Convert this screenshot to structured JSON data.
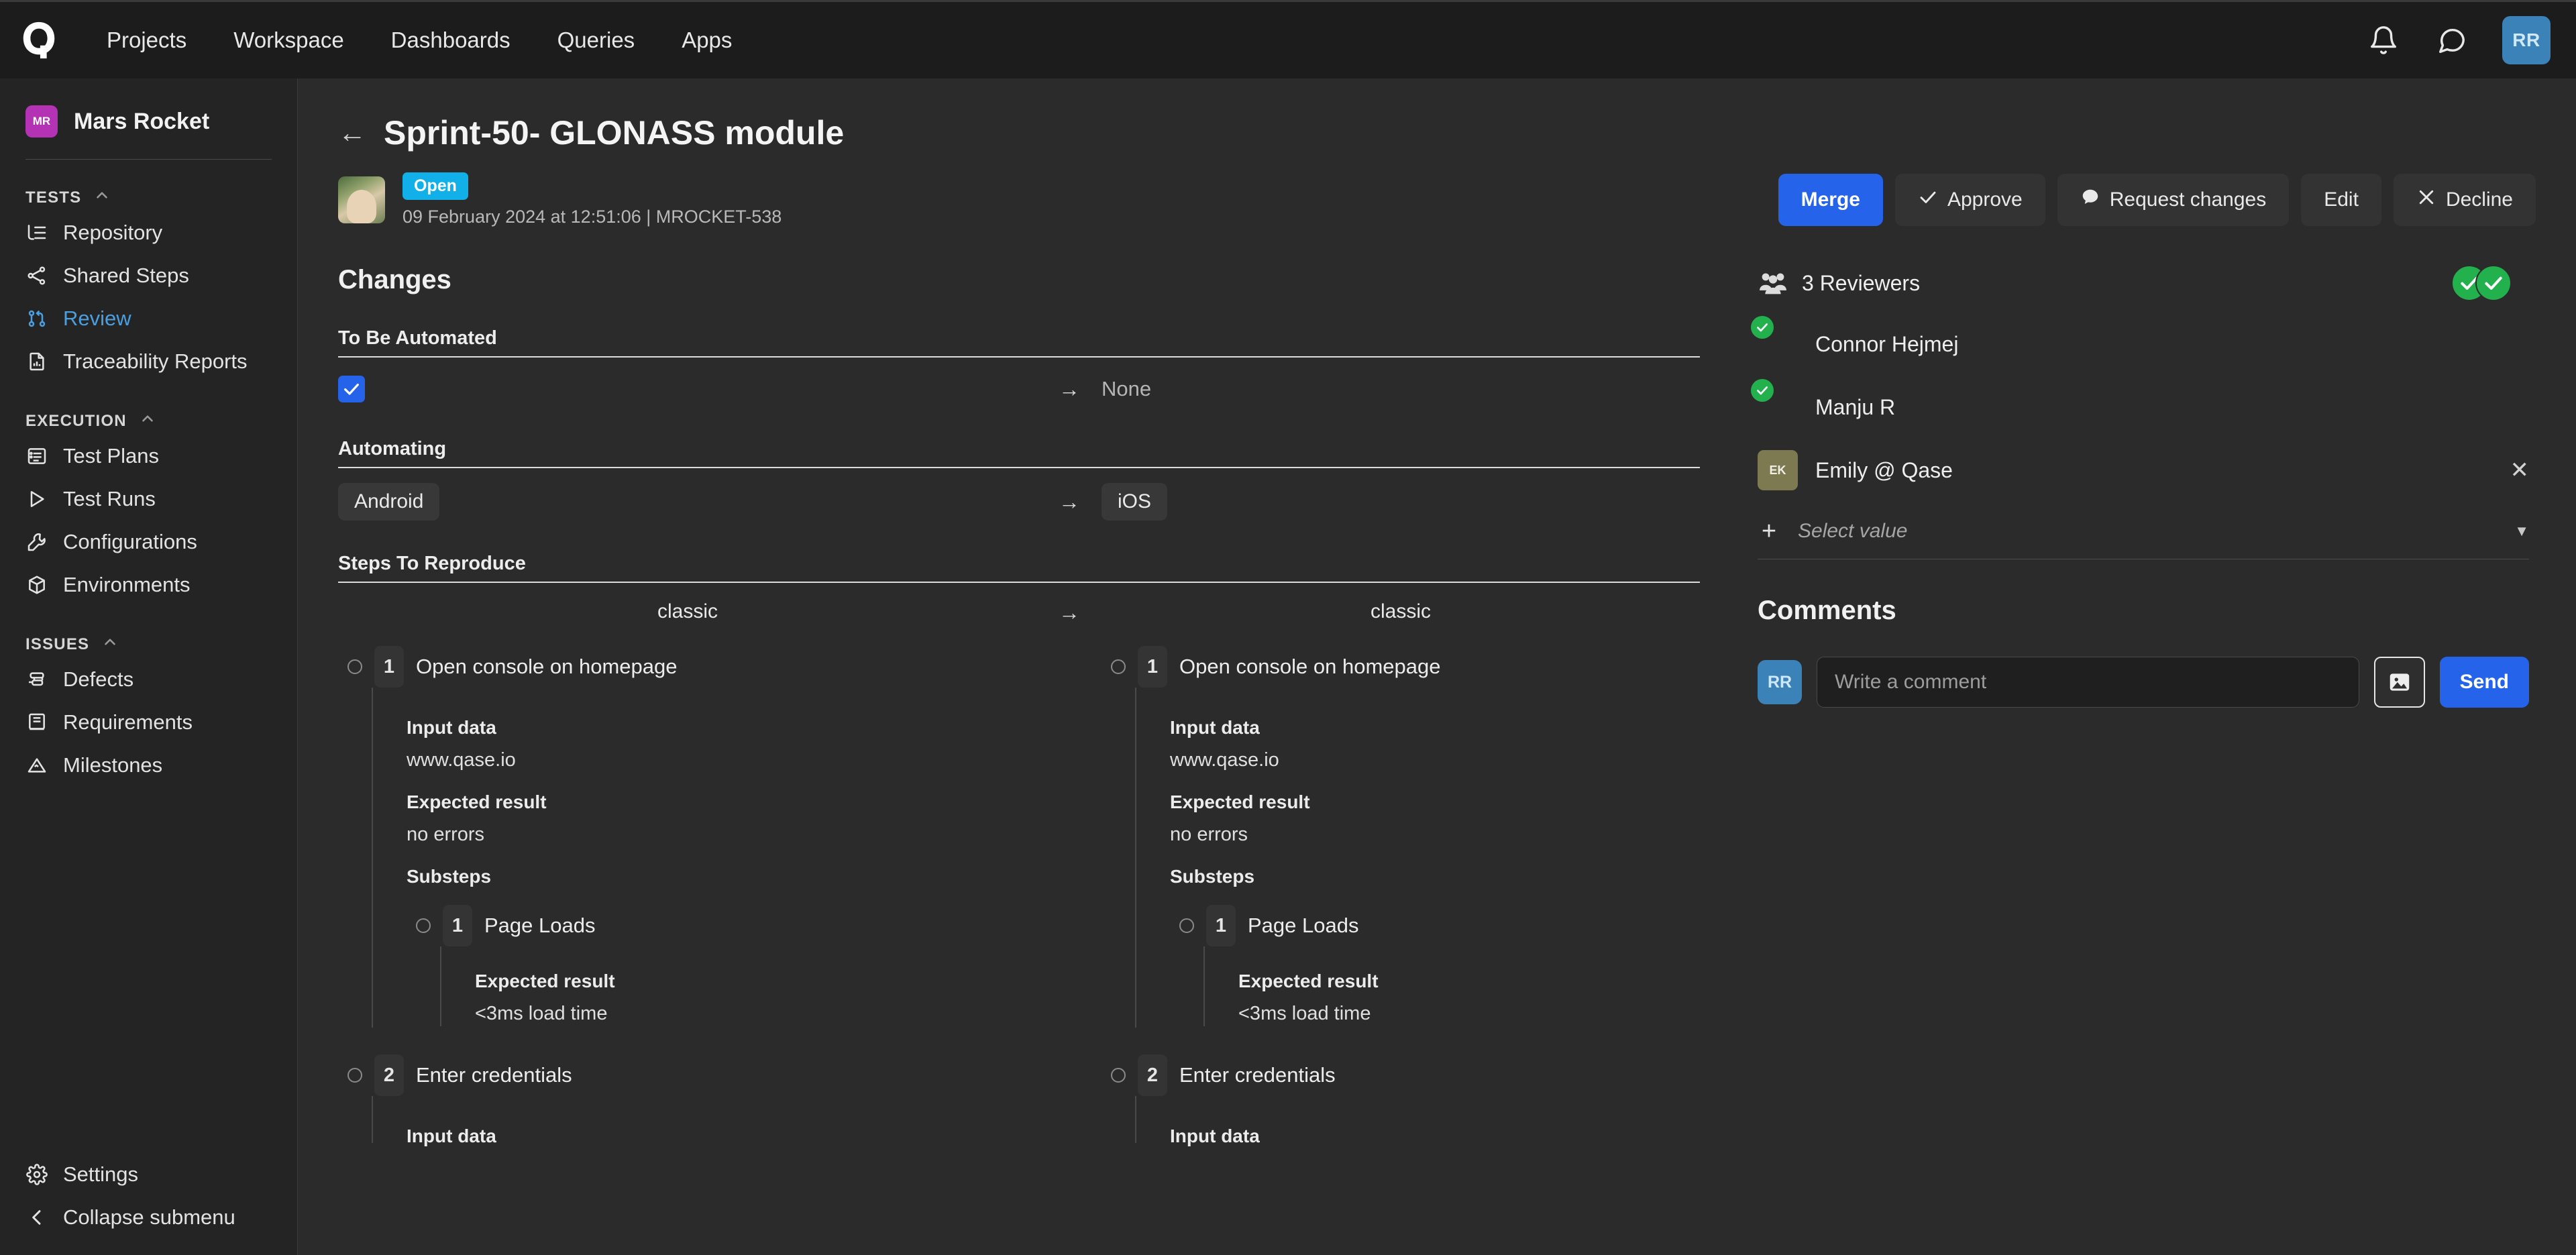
{
  "topbar": {
    "logo": "qase-logo",
    "nav": [
      {
        "label": "Projects"
      },
      {
        "label": "Workspace"
      },
      {
        "label": "Dashboards"
      },
      {
        "label": "Queries"
      },
      {
        "label": "Apps"
      }
    ],
    "notifications_icon": "bell-icon",
    "messages_icon": "chat-bubble-icon",
    "user_initials": "RR"
  },
  "sidebar": {
    "project": {
      "initials": "MR",
      "name": "Mars Rocket",
      "badge_color": "#b432b4"
    },
    "groups": [
      {
        "title": "TESTS",
        "items": [
          {
            "label": "Repository",
            "icon": "list-tree-icon",
            "active": false
          },
          {
            "label": "Shared Steps",
            "icon": "share-nodes-icon",
            "active": false
          },
          {
            "label": "Review",
            "icon": "git-pull-request-icon",
            "active": true
          },
          {
            "label": "Traceability Reports",
            "icon": "report-document-icon",
            "active": false
          }
        ]
      },
      {
        "title": "EXECUTION",
        "items": [
          {
            "label": "Test Plans",
            "icon": "table-list-icon",
            "active": false
          },
          {
            "label": "Test Runs",
            "icon": "play-icon",
            "active": false
          },
          {
            "label": "Configurations",
            "icon": "wrench-icon",
            "active": false
          },
          {
            "label": "Environments",
            "icon": "cube-icon",
            "active": false
          }
        ]
      },
      {
        "title": "ISSUES",
        "items": [
          {
            "label": "Defects",
            "icon": "bug-icon",
            "active": false
          },
          {
            "label": "Requirements",
            "icon": "book-icon",
            "active": false
          },
          {
            "label": "Milestones",
            "icon": "flag-mountain-icon",
            "active": false
          }
        ]
      }
    ],
    "bottom": [
      {
        "label": "Settings",
        "icon": "gear-icon"
      },
      {
        "label": "Collapse submenu",
        "icon": "chevron-left-icon"
      }
    ],
    "active_color": "#4a9fe0"
  },
  "page": {
    "back_icon": "arrow-left-icon",
    "title": "Sprint-50- GLONASS module",
    "status": "Open",
    "status_color": "#12b0e8",
    "meta": "09 February 2024 at 12:51:06 | MROCKET-538"
  },
  "actions": [
    {
      "label": "Merge",
      "icon": null,
      "style": "primary"
    },
    {
      "label": "Approve",
      "icon": "check-icon",
      "style": "ghost"
    },
    {
      "label": "Request changes",
      "icon": "comment-icon",
      "style": "ghost"
    },
    {
      "label": "Edit",
      "icon": null,
      "style": "ghost"
    },
    {
      "label": "Decline",
      "icon": "x-icon",
      "style": "ghost"
    }
  ],
  "changes": {
    "heading": "Changes",
    "fields": [
      {
        "label": "To Be Automated",
        "old_type": "checkbox",
        "old_checked": true,
        "new_type": "text",
        "new_value": "None"
      },
      {
        "label": "Automating",
        "old_type": "tag",
        "old_value": "Android",
        "new_type": "tag",
        "new_value": "iOS"
      }
    ],
    "steps_section": {
      "label": "Steps To Reproduce",
      "old_header": "classic",
      "new_header": "classic",
      "arrow": "→",
      "steps": [
        {
          "num": "1",
          "text": "Open console on homepage",
          "blocks": [
            {
              "label": "Input data",
              "value": "www.qase.io"
            },
            {
              "label": "Expected result",
              "value": "no errors"
            }
          ],
          "substeps_label": "Substeps",
          "substeps": [
            {
              "num": "1",
              "text": "Page Loads",
              "blocks": [
                {
                  "label": "Expected result",
                  "value": "<3ms load time"
                }
              ]
            }
          ]
        },
        {
          "num": "2",
          "text": "Enter credentials",
          "blocks": [
            {
              "label": "Input data",
              "value": ""
            }
          ],
          "substeps_label": null,
          "substeps": []
        }
      ]
    }
  },
  "reviewers": {
    "icon": "people-group-icon",
    "title": "3 Reviewers",
    "approved_badges": 2,
    "approved_color": "#22b14c",
    "list": [
      {
        "name": "Connor Hejmej",
        "approved": true,
        "avatar_type": "photo",
        "initials": "",
        "removable": false
      },
      {
        "name": "Manju R",
        "approved": true,
        "avatar_type": "photo",
        "initials": "",
        "removable": false
      },
      {
        "name": "Emily @ Qase",
        "approved": false,
        "avatar_type": "initials",
        "initials": "EK",
        "removable": true,
        "remove_icon": "x-icon"
      }
    ],
    "add": {
      "plus_icon": "plus-icon",
      "placeholder": "Select value",
      "caret_icon": "chevron-down-icon"
    }
  },
  "comments": {
    "title": "Comments",
    "user_initials": "RR",
    "placeholder": "Write a comment",
    "attach_icon": "image-icon",
    "send_label": "Send"
  }
}
